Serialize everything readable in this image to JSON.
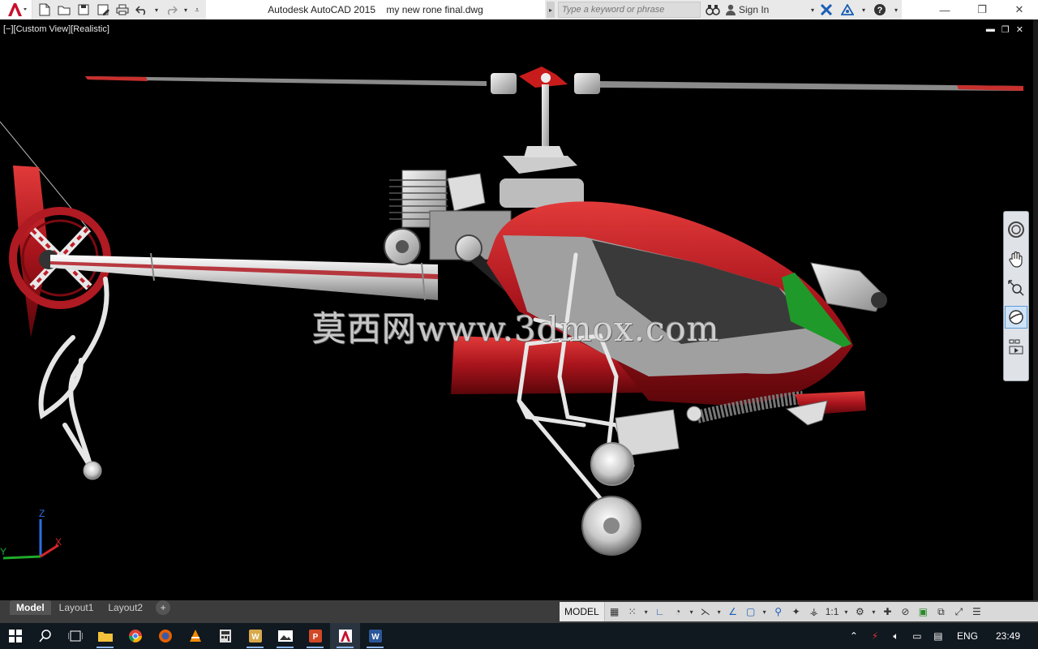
{
  "titlebar": {
    "app_title": "Autodesk AutoCAD 2015",
    "file_name": "my new rone final.dwg",
    "search_placeholder": "Type a keyword or phrase",
    "sign_in": "Sign In"
  },
  "viewport": {
    "view_label": "[−][Custom View][Realistic]",
    "watermark": "莫西网www.3dmox.com",
    "ucs": {
      "x_label": "X",
      "y_label": "Y",
      "z_label": "Z"
    }
  },
  "layout_tabs": [
    {
      "label": "Model",
      "active": true
    },
    {
      "label": "Layout1",
      "active": false
    },
    {
      "label": "Layout2",
      "active": false
    }
  ],
  "add_tab_label": "+",
  "status": {
    "model_label": "MODEL",
    "scale_label": "1:1"
  },
  "taskbar": {
    "language": "ENG",
    "time": "23:49"
  },
  "colors": {
    "body_red": "#a8141c",
    "canopy_grey": "#9a9a9a",
    "window_dark": "#3a3a3a",
    "accent_green": "#1f9a2a",
    "metal_light": "#d8d8d8",
    "taskbar_bg": "#101820"
  },
  "icons": {
    "app_menu": "autocad-logo-icon",
    "new": "new-file-icon",
    "open": "open-folder-icon",
    "save": "save-icon",
    "save_as": "save-as-icon",
    "print": "print-icon",
    "undo": "undo-icon",
    "redo": "redo-icon",
    "search": "search-icon",
    "binoculars": "binoculars-icon",
    "user": "user-icon",
    "exchange": "exchange-icon",
    "a360": "a360-icon",
    "help": "help-icon"
  }
}
